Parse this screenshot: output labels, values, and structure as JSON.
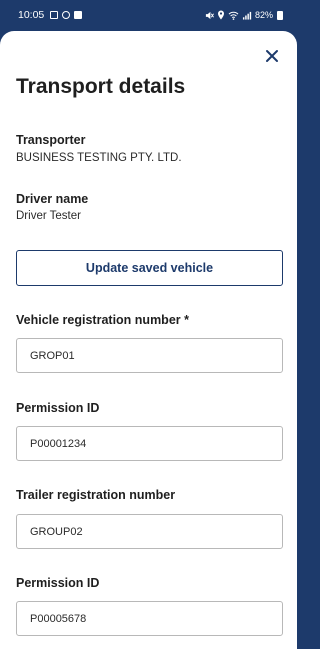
{
  "status_bar": {
    "time": "10:05",
    "battery": "82%",
    "left_icons": [
      "photo-icon",
      "settings-icon",
      "check-icon"
    ],
    "right_icons": [
      "mute-icon",
      "location-icon",
      "wifi-icon",
      "signal-icon",
      "battery-icon"
    ]
  },
  "sheet": {
    "close_icon": "close-icon",
    "title": "Transport details"
  },
  "transporter": {
    "label": "Transporter",
    "value": "BUSINESS TESTING PTY. LTD."
  },
  "driver": {
    "label": "Driver name",
    "value": "Driver Tester"
  },
  "update_button": {
    "label": "Update saved vehicle"
  },
  "vehicle_registration": {
    "label": "Vehicle registration number *",
    "value": "GROP01"
  },
  "vehicle_permission": {
    "label": "Permission ID",
    "value": "P00001234"
  },
  "trailer_registration": {
    "label": "Trailer registration number",
    "value": "GROUP02"
  },
  "trailer_permission": {
    "label": "Permission ID",
    "value": "P00005678"
  },
  "colors": {
    "brand": "#1d3a6b",
    "text": "#1f1f1f",
    "border": "#b8b8b8"
  }
}
